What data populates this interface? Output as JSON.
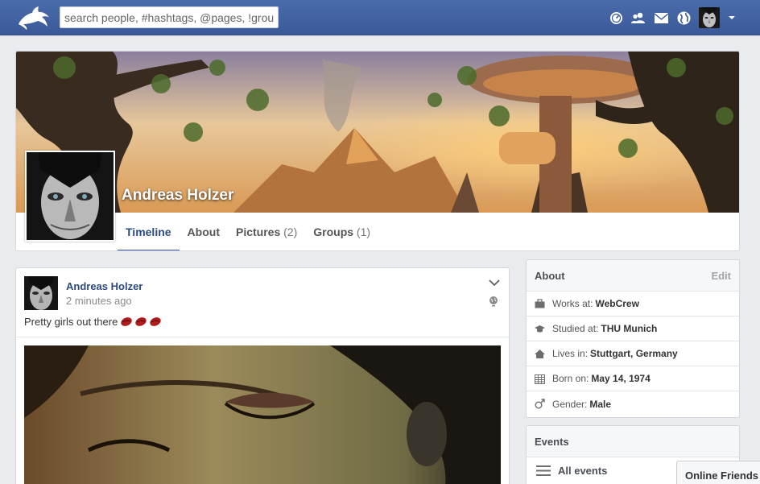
{
  "topbar": {
    "logo_icon": "dolphin-logo-icon",
    "search_placeholder": "search people, #hashtags, @pages, !groups",
    "icons": [
      "dashboard-icon",
      "friends-icon",
      "mail-icon",
      "globe-icon"
    ],
    "bar_color": "#3b5998"
  },
  "profile": {
    "name": "Andreas Holzer",
    "tabs": [
      {
        "label": "Timeline",
        "count": ""
      },
      {
        "label": "About",
        "count": ""
      },
      {
        "label": "Pictures",
        "count": "(2)"
      },
      {
        "label": "Groups",
        "count": "(1)"
      }
    ],
    "active_tab": "Timeline"
  },
  "post": {
    "author": "Andreas Holzer",
    "time": "2 minutes ago",
    "text": "Pretty girls out there",
    "emoji_icons": [
      "lips-icon",
      "lips-icon",
      "lips-icon"
    ]
  },
  "about": {
    "title": "About",
    "edit_label": "Edit",
    "rows": [
      {
        "icon": "briefcase-icon",
        "label": "Works at:",
        "value": "WebCrew"
      },
      {
        "icon": "graduation-cap-icon",
        "label": "Studied at:",
        "value": "THU Munich"
      },
      {
        "icon": "home-icon",
        "label": "Lives in:",
        "value": "Stuttgart, Germany"
      },
      {
        "icon": "calendar-icon",
        "label": "Born on:",
        "value": "May 14, 1974"
      },
      {
        "icon": "male-icon",
        "label": "Gender:",
        "value": "Male"
      }
    ]
  },
  "events": {
    "title": "Events",
    "all_label": "All events"
  },
  "online_friends": {
    "label": "Online Friends"
  }
}
